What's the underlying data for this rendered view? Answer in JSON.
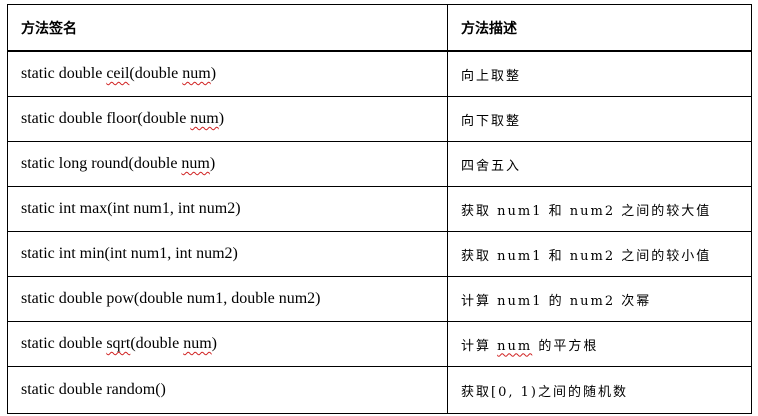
{
  "table": {
    "headers": [
      "方法签名",
      "方法描述"
    ],
    "rows": [
      {
        "sig_a": "static double ",
        "sig_w1": "ceil",
        "sig_b": "(double ",
        "sig_w2": "num",
        "sig_c": ")",
        "desc": "向上取整"
      },
      {
        "sig_a": "static double floor(double ",
        "sig_w1": "num",
        "sig_b": ")",
        "desc": "向下取整"
      },
      {
        "sig_a": "static long round(double ",
        "sig_w1": "num",
        "sig_b": ")",
        "desc": "四舍五入"
      },
      {
        "sig": "static int max(int num1, int num2)",
        "desc": "获取 num1 和 num2 之间的较大值"
      },
      {
        "sig": "static int min(int num1, int num2)",
        "desc": "获取 num1 和 num2 之间的较小值"
      },
      {
        "sig": "static double pow(double num1, double num2)",
        "desc": "计算 num1 的 num2 次幂"
      },
      {
        "sig_a": "static double ",
        "sig_w1": "sqrt",
        "sig_b": "(double ",
        "sig_w2": "num",
        "sig_c": ")",
        "desc_a": "计算 ",
        "desc_w": "num",
        "desc_b": " 的平方根"
      },
      {
        "sig": "static double random()",
        "desc": "获取[0, 1)之间的随机数"
      }
    ]
  },
  "colors": {
    "border": "#000000",
    "text": "#000000",
    "spellcheck_underline": "#d02020",
    "background": "#ffffff"
  }
}
